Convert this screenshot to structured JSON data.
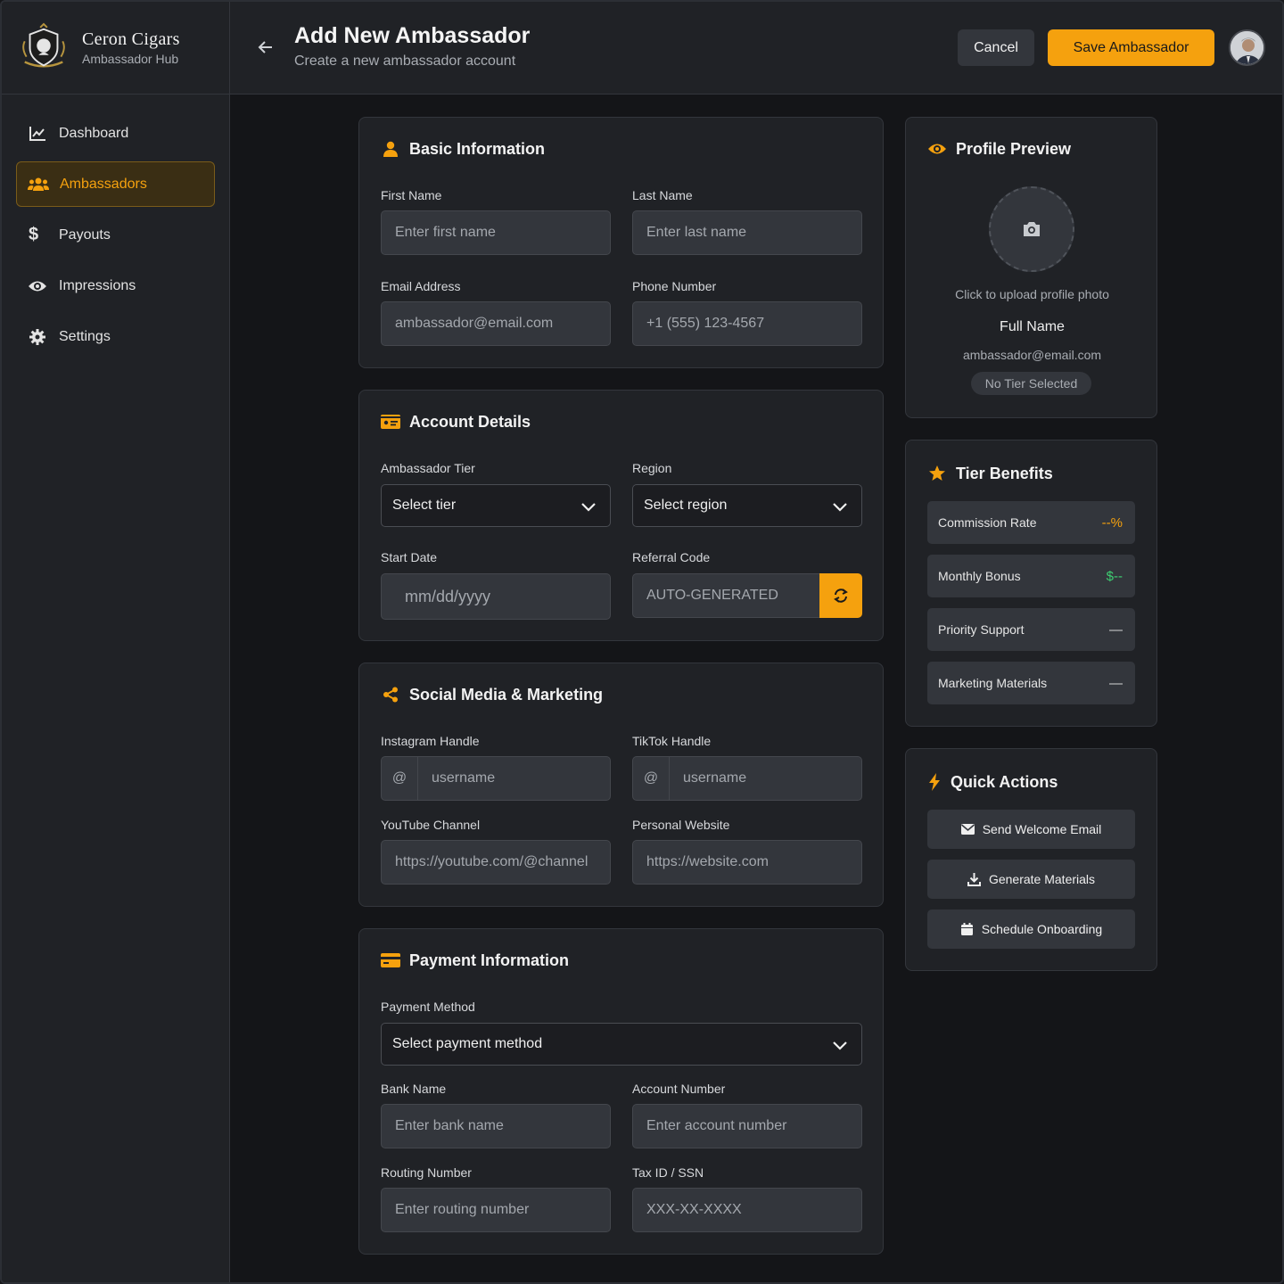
{
  "brand": {
    "name": "Ceron Cigars",
    "subtitle": "Ambassador Hub"
  },
  "sidebar": {
    "items": [
      {
        "label": "Dashboard",
        "icon": "chart-line-icon",
        "active": false
      },
      {
        "label": "Ambassadors",
        "icon": "users-icon",
        "active": true
      },
      {
        "label": "Payouts",
        "icon": "dollar-icon",
        "active": false
      },
      {
        "label": "Impressions",
        "icon": "eye-icon",
        "active": false
      },
      {
        "label": "Settings",
        "icon": "gear-icon",
        "active": false
      }
    ]
  },
  "header": {
    "title": "Add New Ambassador",
    "subtitle": "Create a new ambassador account",
    "cancel_label": "Cancel",
    "save_label": "Save Ambassador"
  },
  "basic": {
    "title": "Basic Information",
    "first_name_label": "First Name",
    "first_name_placeholder": "Enter first name",
    "last_name_label": "Last Name",
    "last_name_placeholder": "Enter last name",
    "email_label": "Email Address",
    "email_placeholder": "ambassador@email.com",
    "phone_label": "Phone Number",
    "phone_placeholder": "+1 (555) 123-4567"
  },
  "account": {
    "title": "Account Details",
    "tier_label": "Ambassador Tier",
    "tier_value": "Select tier",
    "region_label": "Region",
    "region_value": "Select region",
    "start_label": "Start Date",
    "start_placeholder": "mm/dd/yyyy",
    "referral_label": "Referral Code",
    "referral_placeholder": "AUTO-GENERATED"
  },
  "social": {
    "title": "Social Media & Marketing",
    "instagram_label": "Instagram Handle",
    "instagram_prefix": "@",
    "instagram_placeholder": "username",
    "tiktok_label": "TikTok Handle",
    "tiktok_prefix": "@",
    "tiktok_placeholder": "username",
    "youtube_label": "YouTube Channel",
    "youtube_placeholder": "https://youtube.com/@channel",
    "website_label": "Personal Website",
    "website_placeholder": "https://website.com"
  },
  "payment": {
    "title": "Payment Information",
    "method_label": "Payment Method",
    "method_value": "Select payment method",
    "bank_label": "Bank Name",
    "bank_placeholder": "Enter bank name",
    "account_label": "Account Number",
    "account_placeholder": "Enter account number",
    "routing_label": "Routing Number",
    "routing_placeholder": "Enter routing number",
    "tax_label": "Tax ID / SSN",
    "tax_placeholder": "XXX-XX-XXXX"
  },
  "preview": {
    "title": "Profile Preview",
    "upload_text": "Click to upload profile photo",
    "name": "Full Name",
    "email": "ambassador@email.com",
    "tier_badge": "No Tier Selected"
  },
  "tier_benefits": {
    "title": "Tier Benefits",
    "rows": [
      {
        "label": "Commission Rate",
        "value": "--%",
        "color": "#f5a10e"
      },
      {
        "label": "Monthly Bonus",
        "value": "$--",
        "color": "#3ecf72"
      },
      {
        "label": "Priority Support",
        "value": "—",
        "color": "#d6d6d6"
      },
      {
        "label": "Marketing Materials",
        "value": "—",
        "color": "#d6d6d6"
      }
    ]
  },
  "quick_actions": {
    "title": "Quick Actions",
    "buttons": [
      {
        "label": "Send Welcome Email",
        "icon": "envelope-icon"
      },
      {
        "label": "Generate Materials",
        "icon": "download-icon"
      },
      {
        "label": "Schedule Onboarding",
        "icon": "calendar-icon"
      }
    ]
  },
  "colors": {
    "accent": "#f5a10e",
    "panel": "#202226",
    "field": "#33363c",
    "background": "#141518"
  }
}
